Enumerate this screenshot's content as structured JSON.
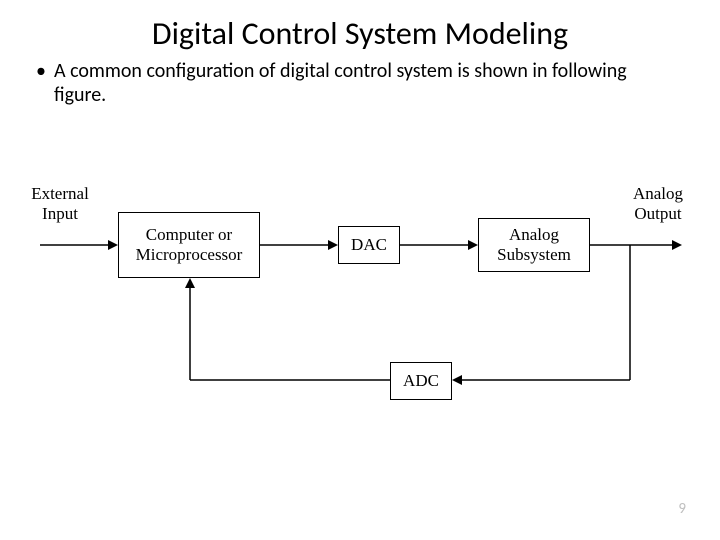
{
  "title": "Digital Control System Modeling",
  "bullet_text": "A common configuration of digital control system is shown in following figure.",
  "page_number": "9",
  "diagram": {
    "input_label": "External\nInput",
    "output_label": "Analog\nOutput",
    "block_computer": "Computer or\nMicroprocessor",
    "block_dac": "DAC",
    "block_analog": "Analog\nSubsystem",
    "block_adc": "ADC"
  }
}
